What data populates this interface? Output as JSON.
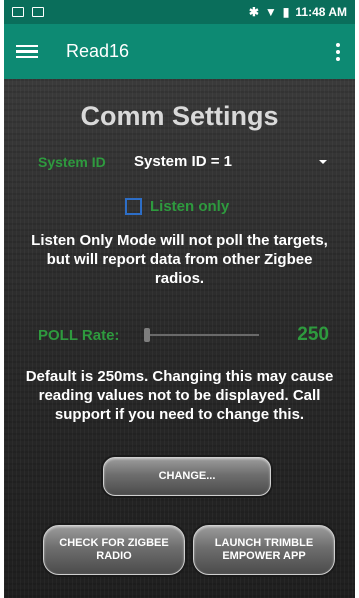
{
  "status_bar": {
    "left_icons": [
      "image-icon",
      "cast-icon"
    ],
    "right_icons": [
      "bluetooth-icon",
      "wifi-icon",
      "battery-icon"
    ],
    "time": "11:48 AM"
  },
  "app_bar": {
    "title": "Read16"
  },
  "page": {
    "title": "Comm Settings",
    "system_id_label": "System ID",
    "system_id_value": "System ID = 1",
    "listen_only_label": "Listen only",
    "listen_only_checked": false,
    "listen_only_note": "Listen Only Mode will not poll the targets, but will report data from other Zigbee radios.",
    "poll_label": "POLL Rate:",
    "poll_value": "250",
    "poll_note": "Default is 250ms. Changing this may cause reading values not to be displayed. Call support if you need to change this."
  },
  "buttons": {
    "change": "CHANGE...",
    "check_zigbee": "CHECK FOR ZIGBEE RADIO",
    "launch_trimble": "LAUNCH TRIMBLE EMPOWER APP"
  },
  "colors": {
    "status_bar": "#0a6e5b",
    "app_bar": "#0d8a73",
    "accent_green": "#2e9a3e",
    "checkbox_blue": "#2d6ec7"
  }
}
